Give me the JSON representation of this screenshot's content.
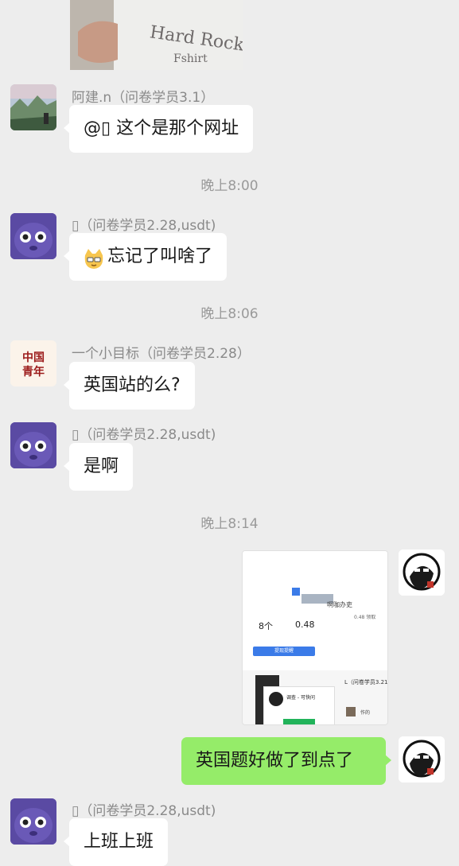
{
  "messages": {
    "m1": {
      "sender": "阿建.n（问卷学员3.1）",
      "text": "@▯  这个是那个网址"
    },
    "t1": "晚上8:00",
    "m2": {
      "sender": "▯（问卷学员2.28,usdt)",
      "text": "忘记了叫啥了",
      "emoji": "cat-face-emoji"
    },
    "t2": "晚上8:06",
    "m3": {
      "sender": "一个小目标（问卷学员2.28）",
      "text": "英国站的么?"
    },
    "m4": {
      "sender": "▯（问卷学员2.28,usdt)",
      "text": "是啊"
    },
    "t3": "晚上8:14",
    "m5": {
      "image": {
        "title_text": "啊咖办吏",
        "stat1_value": "8个",
        "stat2_value": "0.48",
        "button_label": "提现提醒",
        "list_label": "0.48 领取",
        "subheader": "L（问卷学员3.21)",
        "card_title": "调查 - 可快问",
        "small_label": "作的"
      }
    },
    "m6": {
      "text": "英国题好做了到点了"
    },
    "m7": {
      "sender": "▯（问卷学员2.28,usdt)",
      "text": "上班上班"
    }
  },
  "avatars": {
    "jian": "landscape-avatar",
    "purple": "purple-monster-avatar",
    "china_youth": {
      "line1": "中国",
      "line2": "青年"
    },
    "self": "sketch-avatar"
  },
  "colors": {
    "background": "#ededed",
    "green_bubble": "#95ec69",
    "white_bubble": "#ffffff"
  }
}
